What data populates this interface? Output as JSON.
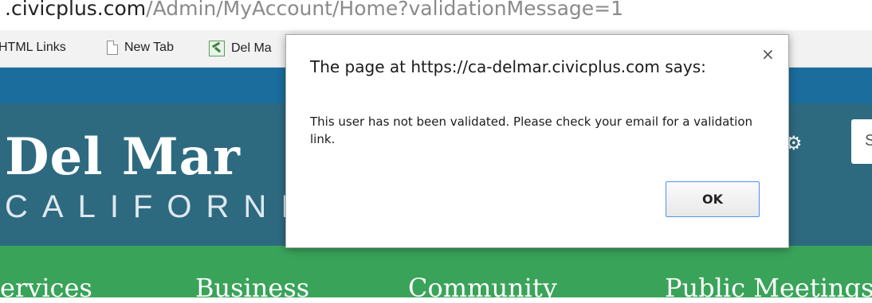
{
  "browser": {
    "url_host": ".civicplus.com",
    "url_path": "/Admin/MyAccount/Home?validationMessage=1",
    "bookmarks": [
      {
        "label": "HTML Links"
      },
      {
        "label": "New Tab",
        "icon": "page-icon"
      },
      {
        "label": "Del Ma",
        "icon": "favicon-icon"
      }
    ]
  },
  "site": {
    "logo_main": "Del Mar",
    "logo_sub": "CALIFORNIA",
    "search_hint": "S",
    "colors": {
      "top_band": "#1a6d9d",
      "header": "#2d6a80",
      "nav": "#3aa35a"
    },
    "nav": [
      "ervices",
      "Business",
      "Community",
      "Public Meetings"
    ]
  },
  "dialog": {
    "title": "The page at https://ca-delmar.civicplus.com says:",
    "message": "This user has not been validated. Please check your email for a validation link.",
    "close_symbol": "×",
    "ok_label": "OK",
    "accent": "#4d90fe"
  }
}
